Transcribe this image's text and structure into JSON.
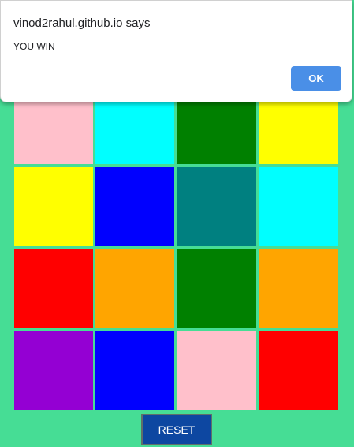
{
  "dialog": {
    "title": "vinod2rahul.github.io says",
    "message": "YOU WIN",
    "ok_label": "OK",
    "ok_color": "#4a8fe7"
  },
  "game": {
    "background": "#46dd95",
    "tiles": [
      [
        "#ffc0cb",
        "#00ffff",
        "#008000",
        "#ffff00"
      ],
      [
        "#ffff00",
        "#0000ff",
        "#008080",
        "#00ffff"
      ],
      [
        "#ff0000",
        "#ffa500",
        "#008000",
        "#ffa500"
      ],
      [
        "#9400d3",
        "#0000ff",
        "#ffc0cb",
        "#ff0000"
      ]
    ],
    "reset_label": "RESET",
    "reset_color": "#0d47a1"
  }
}
